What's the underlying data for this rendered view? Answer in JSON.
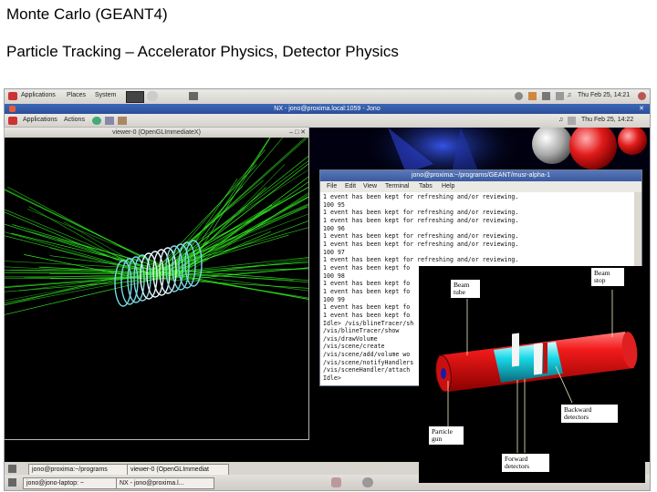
{
  "slide": {
    "title": "Monte Carlo (GEANT4)",
    "subtitle": "Particle Tracking – Accelerator Physics, Detector Physics"
  },
  "top_panel": {
    "applications": "Applications",
    "places": "Places",
    "system": "System",
    "clock": "Thu Feb 25, 14:21"
  },
  "nx_window": {
    "title": "NX - jono@proxima.local:1059 - Jono"
  },
  "remote_panel": {
    "applications": "Applications",
    "actions": "Actions",
    "clock": "Thu Feb 25, 14:22"
  },
  "viewer_window": {
    "title": "viewer-0 (OpenGLImmediateX)"
  },
  "terminal": {
    "title": "jono@proxima:~/programs/GEANT/musr-alpha-1",
    "menu": [
      "File",
      "Edit",
      "View",
      "Terminal",
      "Tabs",
      "Help"
    ],
    "lines": [
      "1 event has been kept for refreshing and/or reviewing.",
      "100 95",
      "1 event has been kept for refreshing and/or reviewing.",
      "1 event has been kept for refreshing and/or reviewing.",
      "100 96",
      "1 event has been kept for refreshing and/or reviewing.",
      "1 event has been kept for refreshing and/or reviewing.",
      "100 97",
      "1 event has been kept for refreshing and/or reviewing.",
      "1 event has been kept fo",
      "100 98",
      "1 event has been kept fo",
      "1 event has been kept fo",
      "100 99",
      "1 event has been kept fo",
      "1 event has been kept fo",
      "Idle> /vis/blineTracer/sh",
      "/vis/blineTracer/show",
      "/vis/drawVolume",
      "/vis/scene/create",
      "/vis/scene/add/volume wo",
      "/vis/scene/notifyHandlers",
      "/vis/sceneHandler/attach",
      "Idle>"
    ]
  },
  "taskbar_remote": {
    "task1": "jono@proxima:~/programs",
    "task2": "viewer-0 (OpenGLImmediat"
  },
  "taskbar_local": {
    "task1": "jono@jono-laptop: ~",
    "task2": "NX - jono@proxima.l..."
  },
  "diagram_labels": {
    "beam_tube": "Beam\ntube",
    "beam_stop": "Beam\nstop",
    "backward_detectors": "Backward\ndetectors",
    "particle_gun": "Particle\ngun",
    "forward_detectors": "Forward\ndetectors"
  },
  "colors": {
    "tracks": "#33ee22",
    "rings": "#7ad8e6",
    "tube": "#e01818",
    "titlebar": "#3f5fa6"
  }
}
